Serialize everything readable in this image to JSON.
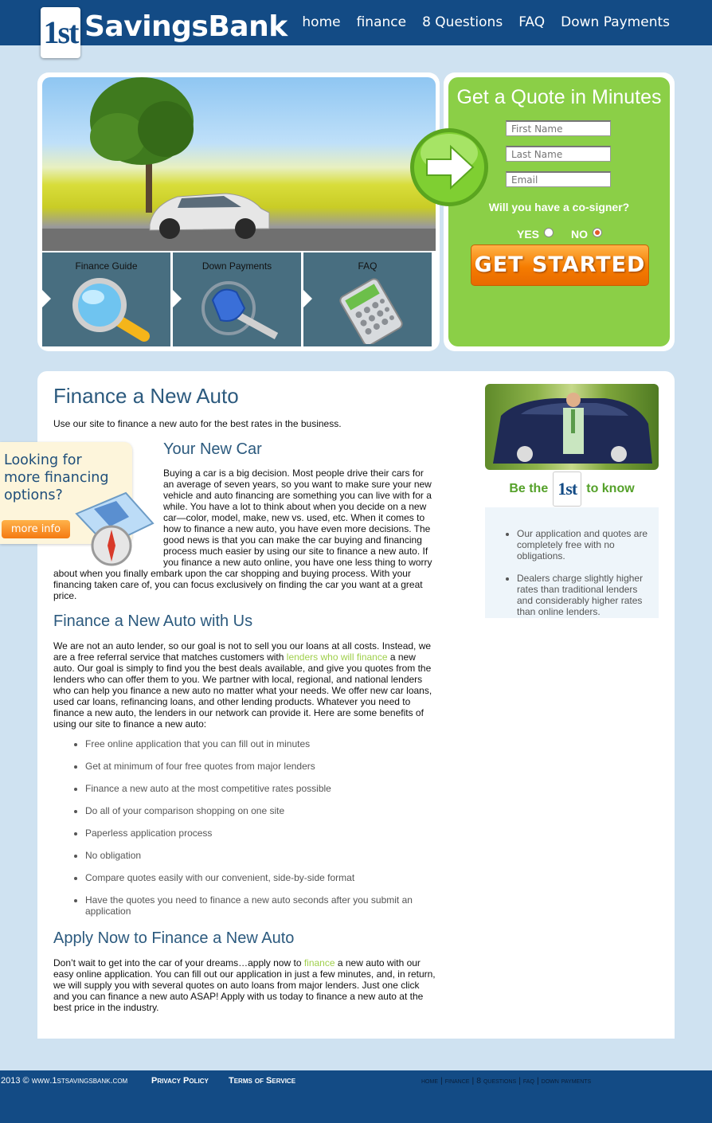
{
  "header": {
    "logo_mark": "1st",
    "brand": "SavingsBank",
    "nav": [
      "home",
      "finance",
      "8 Questions",
      "FAQ",
      "Down Payments"
    ]
  },
  "hero": {
    "tiles": [
      {
        "label": "Finance Guide",
        "icon": "magnifier-icon"
      },
      {
        "label": "Down Payments",
        "icon": "key-icon"
      },
      {
        "label": "FAQ",
        "icon": "calculator-icon"
      }
    ]
  },
  "quote_form": {
    "title": "Get a Quote in Minutes",
    "first_name_placeholder": "First Name",
    "last_name_placeholder": "Last Name",
    "email_placeholder": "Email",
    "cosigner_question": "Will you have a co-signer?",
    "yes_label": "YES",
    "no_label": "NO",
    "selected": "NO",
    "submit_label": "GET STARTED"
  },
  "promo": {
    "text_line1": "Looking for",
    "text_line2": "more financing",
    "text_line3": "options?",
    "button_label": "more info"
  },
  "article": {
    "title": "Finance a New Auto",
    "intro": "Use our site to finance a new auto for the best rates in the business.",
    "section1_title": "Your New Car",
    "section1_body": "Buying a car is a big decision.  Most people drive their cars for an average of seven years, so you want to make sure your new vehicle and auto financing are something you can live with for a while.  You have a lot to think about when you decide on a new car—color, model, make, new vs. used, etc.  When it comes to how to finance a new auto, you have even more decisions.  The good news is that you can make the car buying and financing process much easier by using our site to finance a new auto.  If you finance a new auto online, you have one less thing to worry about when you finally embark upon the car shopping and buying process.  With your financing taken care of, you can focus exclusively on finding the car you want at a great price.",
    "section2_title": "Finance a New Auto with Us",
    "section2_body_a": "We are not an auto lender, so our goal is not to sell you our loans at all costs.  Instead, we are a free referral service that matches customers with ",
    "section2_link": "lenders who will finance",
    "section2_body_b": " a new auto.  Our goal is simply to find you the best deals available, and give you quotes from the lenders who can offer them to you.  We partner with local, regional, and national lenders who can help you finance a new auto no matter what your needs.  We offer new car loans, used car loans, refinancing loans, and other lending products.  Whatever you need to finance a new auto, the lenders in our network can provide it.  Here are some benefits of using our site to finance a new auto:",
    "benefits": [
      "Free online application that you can fill out in minutes",
      "Get at minimum of four free quotes from major lenders",
      "Finance a new auto at the most competitive rates possible",
      "Do all of your comparison shopping on one site",
      "Paperless application process",
      "No obligation",
      "Compare quotes easily with our convenient, side-by-side format",
      "Have the quotes you need to finance a new auto seconds after you submit an application"
    ],
    "section3_title": "Apply Now to Finance a New Auto",
    "section3_body_a": "Don’t wait to get into the car of your dreams…apply now to ",
    "section3_link": "finance",
    "section3_body_b": " a new auto with our easy online application.  You can fill out our application in just a few minutes, and, in return, we will supply you with several quotes on auto loans from major lenders.  Just one click and you can finance a new auto ASAP!  Apply with us today to finance a new auto at the best price in the industry."
  },
  "sidebar": {
    "be_the": "Be the",
    "mark": "1st",
    "to_know": "to know",
    "points": [
      "Our application and quotes are completely free with no obligations.",
      "Dealers charge slightly higher rates than traditional lenders and considerably higher rates than online lenders."
    ]
  },
  "footer": {
    "copyright": "2013 © www.1stsavingsbank.com",
    "privacy": "Privacy Policy",
    "terms": "Terms of Service",
    "nav": [
      "home",
      "finance",
      "8 questions",
      "faq",
      "down payments"
    ]
  }
}
